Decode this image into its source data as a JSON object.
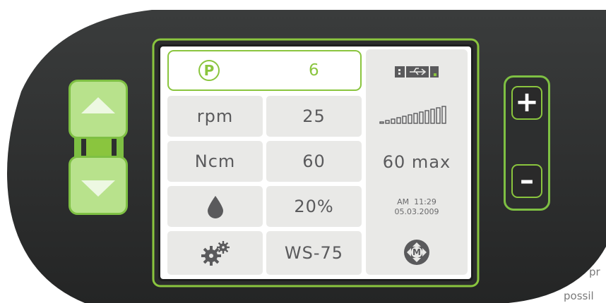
{
  "program": {
    "label": "P",
    "value": "6"
  },
  "rows": [
    {
      "label": "rpm",
      "value": "25"
    },
    {
      "label": "Ncm",
      "value": "60"
    },
    {
      "icon": "water-drop-icon",
      "value": "20%"
    },
    {
      "icon": "gears-icon",
      "value": "WS-75"
    }
  ],
  "status": {
    "usb_icon": "usb-connection-icon",
    "signal_icon": "signal-bar-icon",
    "torque_max": "60 max",
    "time": "AM  11:29",
    "date": "05.03.2009",
    "mode_icon": "motor-mode-icon",
    "mode_label": "M"
  },
  "buttons": {
    "plus": "+",
    "minus": "–",
    "up_icon": "triangle-up-icon",
    "down_icon": "triangle-down-icon"
  },
  "background_text": {
    "line1": "pr",
    "line2": "possil"
  },
  "colors": {
    "accent": "#8ac53e",
    "device_body": "#2d2f2f",
    "cell_bg": "#e9e9e7",
    "cell_text": "#5a5a5c"
  }
}
